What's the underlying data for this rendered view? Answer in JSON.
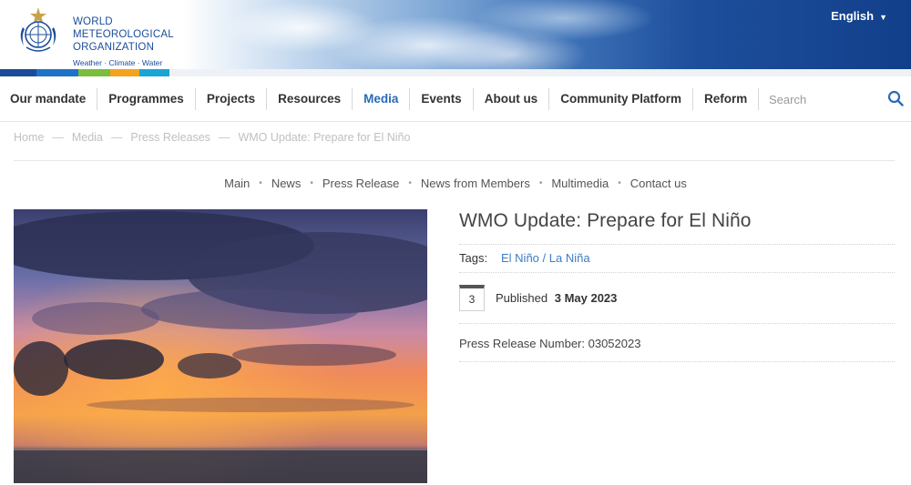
{
  "header": {
    "org_name_line1": "WORLD",
    "org_name_line2": "METEOROLOGICAL",
    "org_name_line3": "ORGANIZATION",
    "tagline": "Weather · Climate · Water",
    "language": "English",
    "brand_color": "#1b4c9a"
  },
  "nav": {
    "items": [
      {
        "label": "Our mandate"
      },
      {
        "label": "Programmes"
      },
      {
        "label": "Projects"
      },
      {
        "label": "Resources"
      },
      {
        "label": "Media",
        "active": true
      },
      {
        "label": "Events"
      },
      {
        "label": "About us"
      },
      {
        "label": "Community Platform"
      },
      {
        "label": "Reform"
      }
    ],
    "search_placeholder": "Search",
    "active_color": "#2a6ab8"
  },
  "breadcrumb": [
    "Home",
    "Media",
    "Press Releases",
    "WMO Update: Prepare for El Niño"
  ],
  "breadcrumb_separator": "—",
  "subnav": [
    "Main",
    "News",
    "Press Release",
    "News from Members",
    "Multimedia",
    "Contact us"
  ],
  "subnav_separator": "•",
  "article": {
    "title": "WMO Update: Prepare for El Niño",
    "tags_label": "Tags:",
    "tag": "El Niño / La Niña",
    "calendar_day": "3",
    "published_label": "Published",
    "published_date": "3 May 2023",
    "press_release_number": "Press Release Number: 03052023"
  }
}
